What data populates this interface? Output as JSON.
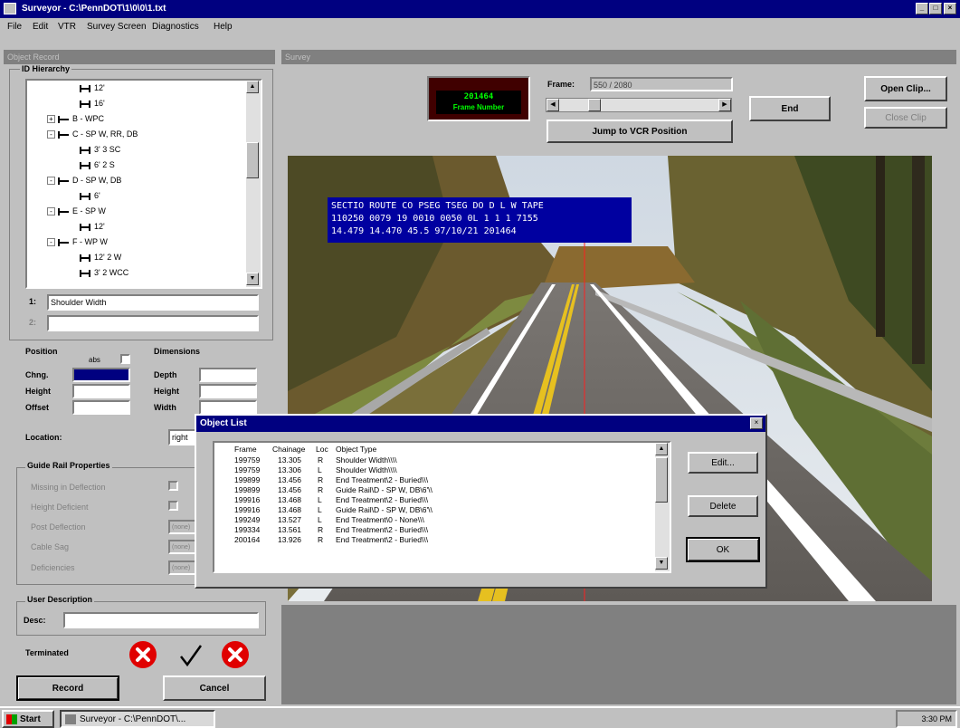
{
  "window": {
    "title": "Surveyor - C:\\PennDOT\\1\\0\\0\\1.txt",
    "min": "_",
    "max": "□",
    "close": "×"
  },
  "menu": [
    "File",
    "Edit",
    "VTR",
    "Survey Screen",
    "Diagnostics",
    "Help"
  ],
  "left_panel": {
    "title": "Object Record",
    "hierarchy_label": "ID Hierarchy",
    "tree": [
      {
        "text": "12'",
        "indent": 3,
        "icon": "length-icon"
      },
      {
        "text": "16'",
        "indent": 3,
        "icon": "length-icon"
      },
      {
        "text": "B - WPC",
        "indent": 2,
        "icon": "node-icon",
        "expander": "+"
      },
      {
        "text": "C - SP W, RR, DB",
        "indent": 2,
        "icon": "node-icon",
        "expander": "-"
      },
      {
        "text": "3' 3 SC",
        "indent": 3,
        "icon": "length-icon"
      },
      {
        "text": "6' 2 S",
        "indent": 3,
        "icon": "length-icon"
      },
      {
        "text": "D - SP W, DB",
        "indent": 2,
        "icon": "node-icon",
        "expander": "-"
      },
      {
        "text": "6'",
        "indent": 3,
        "icon": "length-icon"
      },
      {
        "text": "E - SP W",
        "indent": 2,
        "icon": "node-icon",
        "expander": "-"
      },
      {
        "text": "12'",
        "indent": 3,
        "icon": "length-icon"
      },
      {
        "text": "F - WP W",
        "indent": 2,
        "icon": "node-icon",
        "expander": "-"
      },
      {
        "text": "12' 2 W",
        "indent": 3,
        "icon": "length-icon"
      },
      {
        "text": "3' 2 WCC",
        "indent": 3,
        "icon": "length-icon"
      }
    ],
    "field1_label": "1:",
    "field1_value": "Shoulder Width",
    "field2_label": "2:",
    "field2_value": "",
    "position": {
      "title": "Position",
      "abs_label": "abs",
      "chng_label": "Chng.",
      "height_label": "Height",
      "offset_label": "Offset"
    },
    "dimensions": {
      "title": "Dimensions",
      "depth_label": "Depth",
      "height_label": "Height",
      "width_label": "Width"
    },
    "location_label": "Location:",
    "location_value": "right",
    "guide_rail": {
      "title": "Guide Rail Properties",
      "missing": "Missing in Deflection",
      "height_deficient": "Height Deficient",
      "post_deflection": "Post Deflection",
      "cable_sag": "Cable Sag",
      "deficiencies": "Deficiencies",
      "post_value": "(none)",
      "cable_value": "(none)",
      "def_value": "(none)"
    },
    "user_description": {
      "title": "User Description",
      "desc_label": "Desc:",
      "desc_value": ""
    },
    "terminated_label": "Terminated",
    "record_button": "Record",
    "cancel_button": "Cancel"
  },
  "survey_panel": {
    "title": "Survey",
    "frame_counter": "201464",
    "frame_number_label": "Frame Number",
    "frame_label": "Frame:",
    "frame_value": "550 / 2080",
    "end_button": "End",
    "open_clip_button": "Open Clip...",
    "close_clip_button": "Close Clip",
    "jump_button": "Jump to VCR Position",
    "overlay_lines": [
      "SECTIO ROUTE CO PSEG TSEG DO D L W TAPE",
      "110250 0079 19 0010 0050 0L 1 1 1 7155",
      "14.479 14.470 45.5 97/10/21 201464"
    ]
  },
  "dialog": {
    "title": "Object List",
    "close": "×",
    "headers": {
      "frame": "Frame",
      "chainage": "Chainage",
      "loc": "Loc",
      "type": "Object Type"
    },
    "rows": [
      {
        "frame": "199759",
        "chainage": "13.305",
        "loc": "R",
        "type": "Shoulder Width\\\\\\\\"
      },
      {
        "frame": "199759",
        "chainage": "13.306",
        "loc": "L",
        "type": "Shoulder Width\\\\\\\\"
      },
      {
        "frame": "199899",
        "chainage": "13.456",
        "loc": "R",
        "type": "End Treatment\\2 - Buried\\\\\\"
      },
      {
        "frame": "199899",
        "chainage": "13.456",
        "loc": "R",
        "type": "Guide Rail\\D - SP W, DB\\6'\\\\"
      },
      {
        "frame": "199916",
        "chainage": "13.468",
        "loc": "L",
        "type": "End Treatment\\2 - Buried\\\\\\"
      },
      {
        "frame": "199916",
        "chainage": "13.468",
        "loc": "L",
        "type": "Guide Rail\\D - SP W, DB\\6'\\\\"
      },
      {
        "frame": "199249",
        "chainage": "13.527",
        "loc": "L",
        "type": "End Treatment\\0 - None\\\\\\"
      },
      {
        "frame": "199334",
        "chainage": "13.561",
        "loc": "R",
        "type": "End Treatment\\2 - Buried\\\\\\"
      },
      {
        "frame": "200164",
        "chainage": "13.926",
        "loc": "R",
        "type": "End Treatment\\2 - Buried\\\\\\"
      }
    ],
    "edit_button": "Edit...",
    "delete_button": "Delete",
    "ok_button": "OK"
  },
  "taskbar": {
    "start": "Start",
    "task": "Surveyor - C:\\PennDOT\\...",
    "clock": "3:30 PM"
  }
}
